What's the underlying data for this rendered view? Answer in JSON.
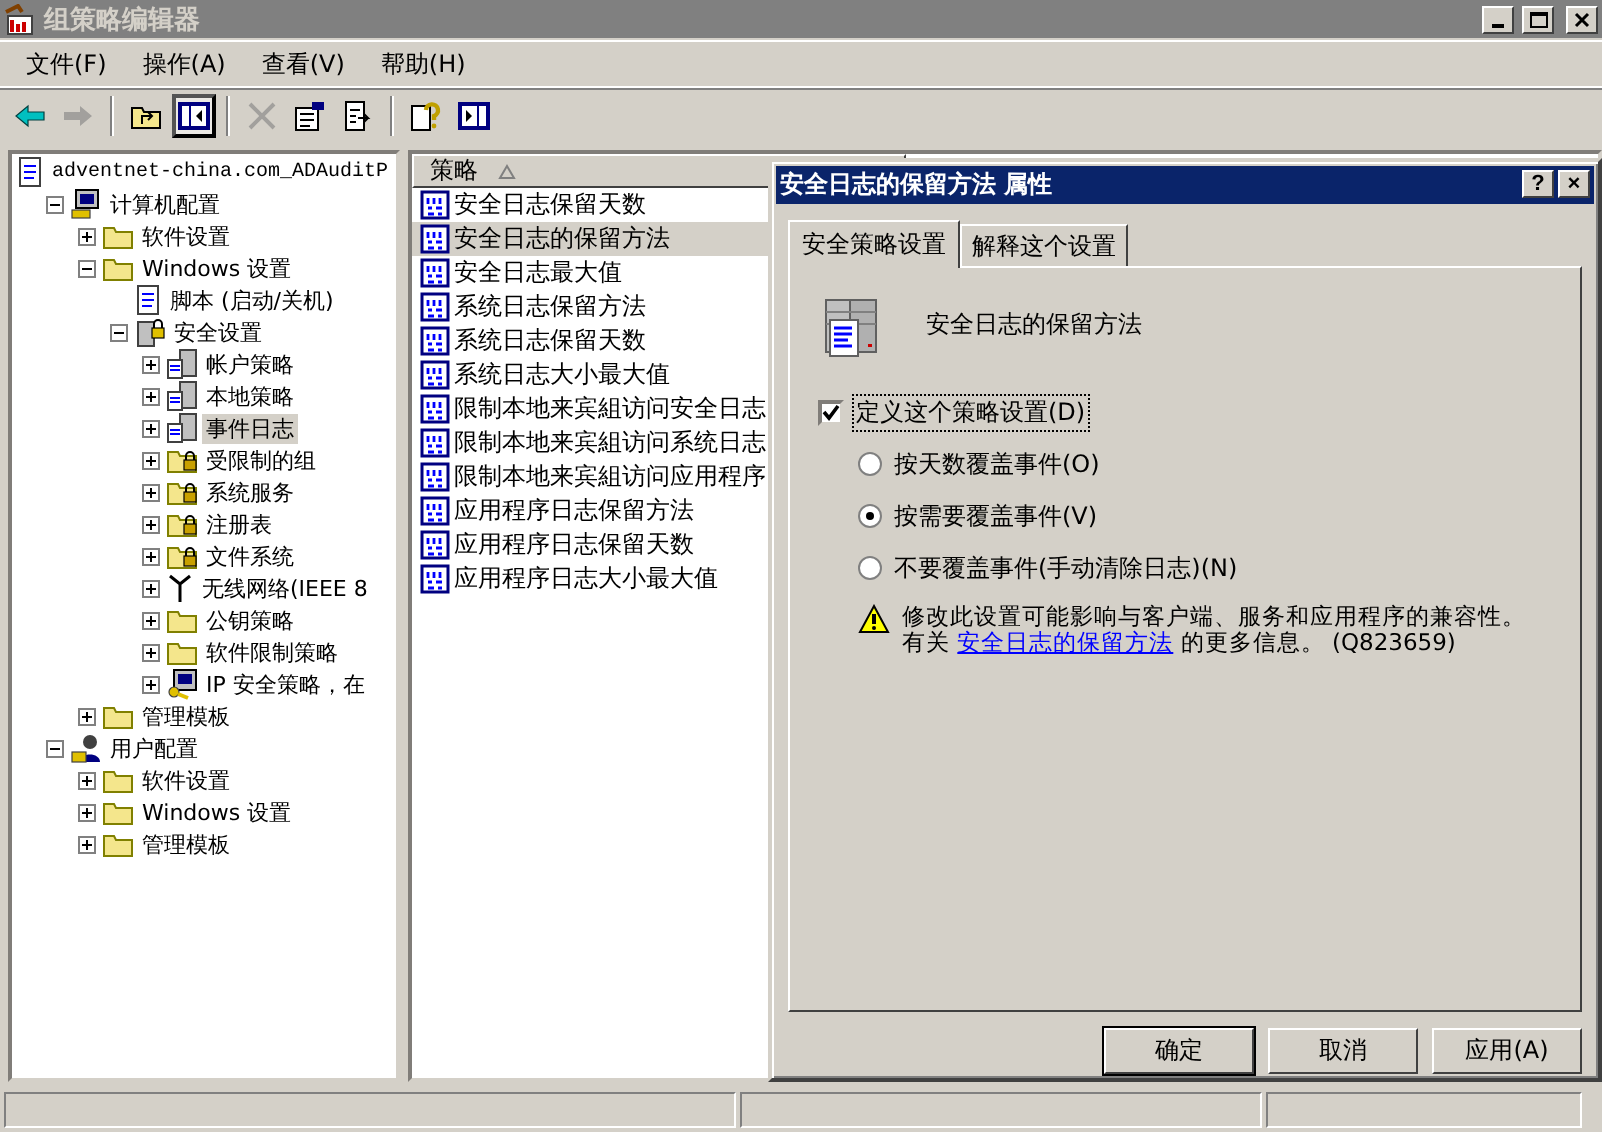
{
  "window": {
    "title": "组策略编辑器"
  },
  "menu": [
    {
      "label": "文件(F)"
    },
    {
      "label": "操作(A)"
    },
    {
      "label": "查看(V)"
    },
    {
      "label": "帮助(H)"
    }
  ],
  "toolbar": [
    {
      "kind": "back",
      "disabled": false,
      "pressed": false
    },
    {
      "kind": "forward",
      "disabled": true,
      "pressed": false
    },
    {
      "kind": "sep"
    },
    {
      "kind": "up",
      "disabled": false,
      "pressed": false
    },
    {
      "kind": "tree",
      "disabled": false,
      "pressed": true
    },
    {
      "kind": "sep"
    },
    {
      "kind": "delete",
      "disabled": true,
      "pressed": false
    },
    {
      "kind": "properties",
      "disabled": false,
      "pressed": false
    },
    {
      "kind": "export",
      "disabled": false,
      "pressed": false
    },
    {
      "kind": "sep"
    },
    {
      "kind": "help",
      "disabled": false,
      "pressed": false
    },
    {
      "kind": "pane",
      "disabled": false,
      "pressed": false
    }
  ],
  "tree": [
    {
      "label": "adventnet-china.com_ADAuditP",
      "kind": "script",
      "selected": false,
      "children": [
        {
          "label": "计算机配置",
          "kind": "computer",
          "expanded": true,
          "selected": false,
          "children": [
            {
              "label": "软件设置",
              "kind": "folder",
              "expanded": false,
              "selected": false
            },
            {
              "label": "Windows 设置",
              "kind": "folder",
              "expanded": true,
              "selected": false,
              "children": [
                {
                  "label": "脚本 (启动/关机)",
                  "kind": "script",
                  "selected": false
                },
                {
                  "label": "安全设置",
                  "kind": "security",
                  "expanded": true,
                  "selected": false,
                  "children": [
                    {
                      "label": "帐户策略",
                      "kind": "policy",
                      "expanded": false,
                      "selected": false
                    },
                    {
                      "label": "本地策略",
                      "kind": "policy",
                      "expanded": false,
                      "selected": false
                    },
                    {
                      "label": "事件日志",
                      "kind": "policy",
                      "expanded": false,
                      "selected": true
                    },
                    {
                      "label": "受限制的组",
                      "kind": "lockfolder",
                      "expanded": false,
                      "selected": false
                    },
                    {
                      "label": "系统服务",
                      "kind": "lockfolder",
                      "expanded": false,
                      "selected": false
                    },
                    {
                      "label": "注册表",
                      "kind": "lockfolder",
                      "expanded": false,
                      "selected": false
                    },
                    {
                      "label": "文件系统",
                      "kind": "lockfolder",
                      "expanded": false,
                      "selected": false
                    },
                    {
                      "label": "无线网络(IEEE 8",
                      "kind": "antenna",
                      "expanded": false,
                      "selected": false
                    },
                    {
                      "label": "公钥策略",
                      "kind": "folder",
                      "expanded": false,
                      "selected": false
                    },
                    {
                      "label": "软件限制策略",
                      "kind": "folder",
                      "expanded": false,
                      "selected": false
                    },
                    {
                      "label": "IP 安全策略，在",
                      "kind": "ip",
                      "expanded": false,
                      "selected": false
                    }
                  ]
                }
              ]
            },
            {
              "label": "管理模板",
              "kind": "folder",
              "expanded": false,
              "selected": false
            }
          ]
        },
        {
          "label": "用户配置",
          "kind": "user",
          "expanded": true,
          "selected": false,
          "children": [
            {
              "label": "软件设置",
              "kind": "folder",
              "expanded": false,
              "selected": false
            },
            {
              "label": "Windows 设置",
              "kind": "folder",
              "expanded": false,
              "selected": false
            },
            {
              "label": "管理模板",
              "kind": "folder",
              "expanded": false,
              "selected": false
            }
          ]
        }
      ]
    }
  ],
  "list": {
    "column": "策略",
    "items": [
      {
        "label": "安全日志保留天数",
        "selected": false
      },
      {
        "label": "安全日志的保留方法",
        "selected": true
      },
      {
        "label": "安全日志最大值",
        "selected": false
      },
      {
        "label": "系统日志保留方法",
        "selected": false
      },
      {
        "label": "系统日志保留天数",
        "selected": false
      },
      {
        "label": "系统日志大小最大值",
        "selected": false
      },
      {
        "label": "限制本地来宾組访问安全日志",
        "selected": false
      },
      {
        "label": "限制本地来宾組访问系统日志",
        "selected": false
      },
      {
        "label": "限制本地来宾組访问应用程序",
        "selected": false
      },
      {
        "label": "应用程序日志保留方法",
        "selected": false
      },
      {
        "label": "应用程序日志保留天数",
        "selected": false
      },
      {
        "label": "应用程序日志大小最大值",
        "selected": false
      }
    ]
  },
  "dialog": {
    "title": "安全日志的保留方法 属性",
    "title_buttons": [
      "?",
      "×"
    ],
    "tabs": [
      {
        "label": "安全策略设置",
        "selected": true
      },
      {
        "label": "解释这个设置",
        "selected": false
      }
    ],
    "heading": "安全日志的保留方法",
    "define": {
      "label": "定义这个策略设置(D)",
      "checked": true
    },
    "options": [
      {
        "label": "按天数覆盖事件(O)",
        "selected": false
      },
      {
        "label": "按需要覆盖事件(V)",
        "selected": true
      },
      {
        "label": "不要覆盖事件(手动清除日志)(N)",
        "selected": false
      }
    ],
    "warning": "修改此设置可能影响与客户端、服务和应用程序的兼容性。",
    "info": {
      "before": "有关 ",
      "link": "安全日志的保留方法",
      "after": " 的更多信息。 (Q823659)"
    },
    "buttons": [
      {
        "label": "确定",
        "default": true
      },
      {
        "label": "取消",
        "default": false
      },
      {
        "label": "应用(A)",
        "default": false
      }
    ]
  }
}
